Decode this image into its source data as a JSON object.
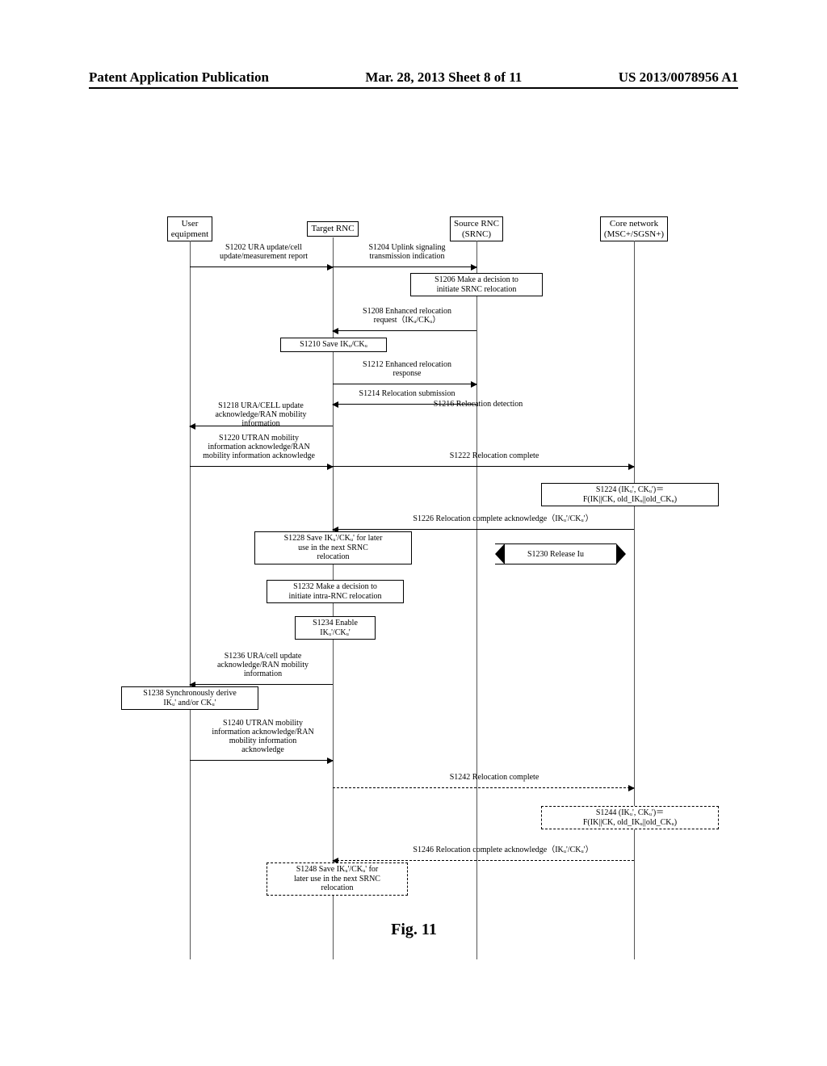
{
  "header": {
    "left": "Patent Application Publication",
    "center": "Mar. 28, 2013  Sheet 8 of 11",
    "right": "US 2013/0078956 A1"
  },
  "actors": {
    "ue": "User\nequipment",
    "target": "Target RNC",
    "source": "Source RNC\n(SRNC)",
    "core": "Core network\n(MSC+/SGSN+)"
  },
  "messages": {
    "s1202": "S1202  URA update/cell\nupdate/measurement report",
    "s1204": "S1204 Uplink signaling\ntransmission indication",
    "s1206": "S1206 Make a decision to\ninitiate SRNC relocation",
    "s1208": "S1208 Enhanced relocation\nrequest（IKᵤ/CKᵤ）",
    "s1210": "S1210 Save IKᵤ/CKᵤ",
    "s1212": "S1212 Enhanced relocation\nresponse",
    "s1214": "S1214 Relocation submission",
    "s1216": "S1216 Relocation detection",
    "s1218": "S1218 URA/CELL update\nacknowledge/RAN mobility\ninformation",
    "s1220": "S1220 UTRAN mobility\ninformation acknowledge/RAN\nmobility information acknowledge",
    "s1222": "S1222 Relocation complete",
    "s1224": "S1224 (IKᵤ', CKᵤ')＝\nF(IK||CK, old_IKᵤ||old_CKᵤ)",
    "s1226": "S1226 Relocation complete acknowledge（IKᵤ'/CKᵤ'）",
    "s1228": "S1228 Save IKᵤ'/CKᵤ' for later\nuse in the next SRNC\nrelocation",
    "s1230": "S1230 Release Iu",
    "s1232": "S1232 Make a decision to\ninitiate intra-RNC relocation",
    "s1234": "S1234 Enable\nIKᵤ'/CKᵤ'",
    "s1236": "S1236 URA/cell update\nacknowledge/RAN mobility\ninformation",
    "s1238": "S1238 Synchronously derive\nIKᵤ' and/or CKᵤ'",
    "s1240": "S1240 UTRAN mobility\ninformation acknowledge/RAN\nmobility information\nacknowledge",
    "s1242": "S1242 Relocation complete",
    "s1244": "S1244 (IKᵤ', CKᵤ')＝\nF(IK||CK, old_IKᵤ||old_CKᵤ)",
    "s1246": "S1246 Relocation complete acknowledge（IKᵤ'/CKᵤ'）",
    "s1248": "S1248 Save IKᵤ'/CKᵤ' for\nlater use in the next SRNC\nrelocation"
  },
  "figure": "Fig. 11"
}
